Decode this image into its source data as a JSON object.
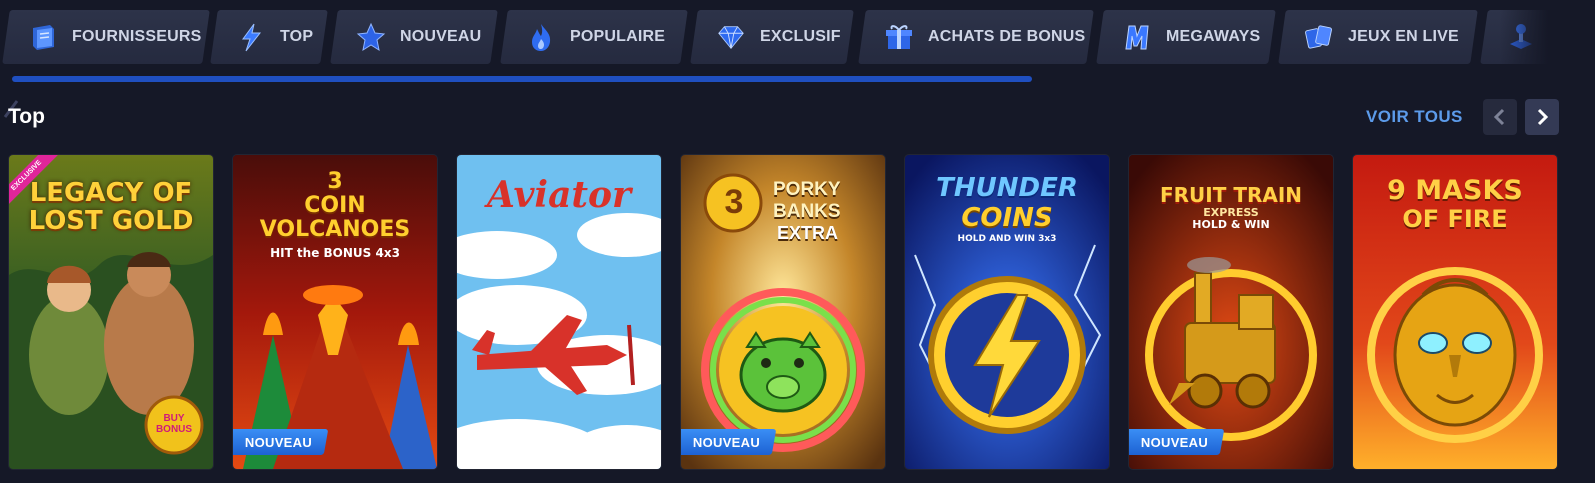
{
  "categories": [
    {
      "label": "Fournisseurs",
      "icon": "book-icon"
    },
    {
      "label": "Top",
      "icon": "lightning-icon"
    },
    {
      "label": "Nouveau",
      "icon": "star-icon"
    },
    {
      "label": "Populaire",
      "icon": "flame-icon"
    },
    {
      "label": "Exclusif",
      "icon": "diamond-icon"
    },
    {
      "label": "Achats de bonus",
      "icon": "gift-icon"
    },
    {
      "label": "Megaways",
      "icon": "megaways-m-icon"
    },
    {
      "label": "Jeux en live",
      "icon": "cards-icon"
    },
    {
      "label": "",
      "icon": "joystick-icon"
    }
  ],
  "section": {
    "title": "Top",
    "see_all": "VOIR TOUS"
  },
  "games": [
    {
      "title_line1": "LEGACY OF",
      "title_line2": "LOST GOLD",
      "badge": "",
      "ribbon": "EXCLUSIVE",
      "extra": "BUY BONUS"
    },
    {
      "title_line1": "3",
      "title_line2": "COIN",
      "title_line3": "VOLCANOES",
      "subtitle": "HIT the BONUS 4x3",
      "badge": "NOUVEAU"
    },
    {
      "title_line1": "Aviator",
      "badge": ""
    },
    {
      "title_line1": "3",
      "title_line2": "PORKY",
      "title_line3": "BANKS",
      "title_line4": "EXTRA",
      "badge": "NOUVEAU"
    },
    {
      "title_line1": "THUNDER",
      "title_line2": "COINS",
      "subtitle": "HOLD AND WIN 3x3",
      "badge": ""
    },
    {
      "title_line1": "FRUIT TRAIN",
      "title_line2": "EXPRESS",
      "subtitle": "HOLD & WIN",
      "badge": "NOUVEAU"
    },
    {
      "title_line1": "9 MASKS",
      "title_line2": "OF FIRE",
      "badge": ""
    }
  ],
  "colors": {
    "background": "#151827",
    "accent": "#1f4fc0",
    "see_all": "#5c9bea",
    "badge_new": "#2b78e8"
  }
}
